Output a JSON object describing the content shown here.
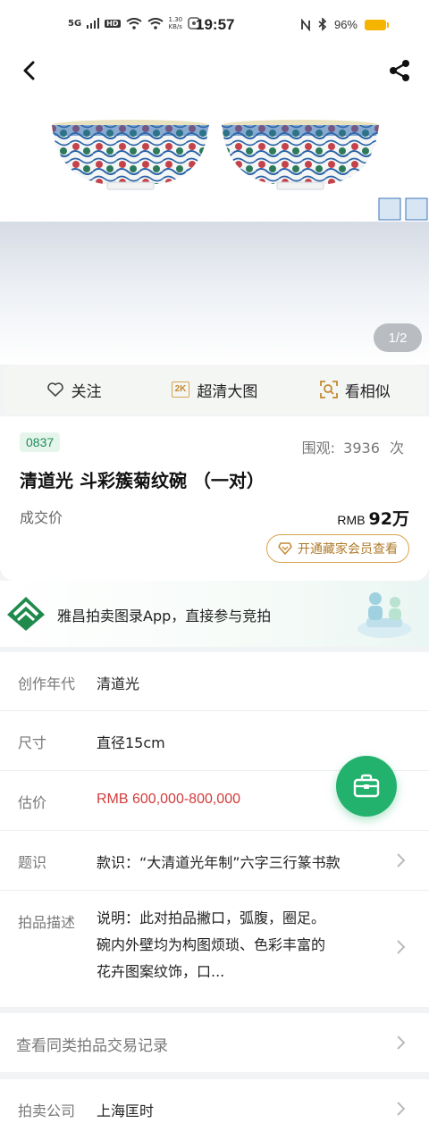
{
  "status_bar": {
    "network": "5G",
    "hd": "HD",
    "speed": "1.30",
    "speed_unit": "KB/s",
    "time": "19:57",
    "battery": "96%"
  },
  "gallery": {
    "page_indicator": "1/2"
  },
  "actions": {
    "follow_label": "关注",
    "hd_badge": "2K",
    "hd_label": "超清大图",
    "similar_label": "看相似"
  },
  "lot": {
    "number": "0837",
    "views_label": "围观:",
    "views_count": "3936",
    "views_unit": "次",
    "title": "清道光 斗彩簇菊纹碗 （一对）",
    "deal_label": "成交价",
    "deal_currency": "RMB",
    "deal_price": "92万",
    "vip_button": "开通藏家会员查看"
  },
  "promo": {
    "text": "雅昌拍卖图录App，直接参与竞拍"
  },
  "details": [
    {
      "key": "创作年代",
      "value": "清道光"
    },
    {
      "key": "尺寸",
      "value": "直径15cm"
    },
    {
      "key": "估价",
      "value": "RMB  600,000-800,000"
    },
    {
      "key": "题识",
      "value": "款识：“大清道光年制”六字三行篆书款"
    },
    {
      "key": "拍品描述",
      "value_lines": [
        "说明：此对拍品撇口，弧腹，圈足。",
        "碗内外壁均为构图烦琐、色彩丰富的",
        "花卉图案纹饰，口..."
      ]
    }
  ],
  "record_link": "查看同类拍品交易记录",
  "company": {
    "key": "拍卖公司",
    "value": "上海匡时"
  },
  "colors": {
    "accent_green": "#23b26d",
    "gold": "#d9a24c",
    "price_red": "#d23b3b"
  }
}
